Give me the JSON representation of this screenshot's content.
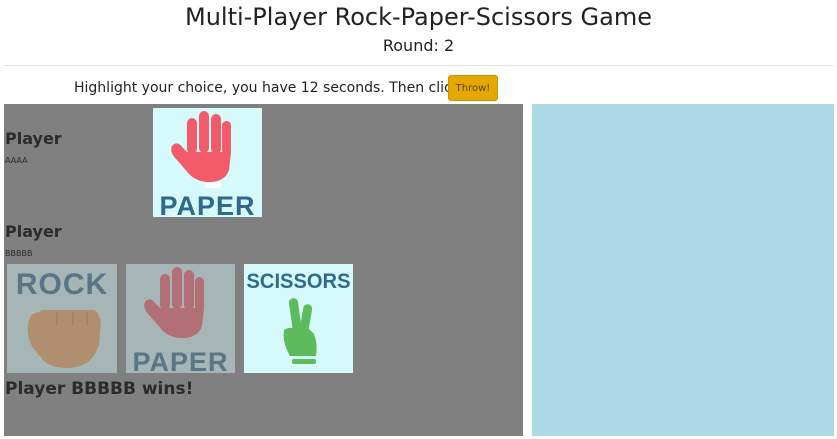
{
  "header": {
    "title": "Multi-Player Rock-Paper-Scissors Game",
    "round_label": "Round: 2"
  },
  "instruction": {
    "text": "Highlight your choice, you have 12 seconds. Then click:",
    "button_label": "Throw!"
  },
  "players": [
    {
      "name": "Player",
      "id": "AAAA",
      "choice": "PAPER"
    },
    {
      "name": "Player",
      "id": "BBBBB"
    }
  ],
  "choices": [
    {
      "label": "ROCK",
      "selected": false
    },
    {
      "label": "PAPER",
      "selected": false
    },
    {
      "label": "SCISSORS",
      "selected": true
    }
  ],
  "result": "Player BBBBB wins!",
  "colors": {
    "board": "#808080",
    "side_panel": "#add8e6",
    "card_bg": "#d6f9f9",
    "button": "#e6a800",
    "label_blue": "#2e6a8e",
    "paper_hand": "#f25c6a",
    "rock_fist": "#e9a35c",
    "scissors_hand": "#5dbb5d"
  }
}
